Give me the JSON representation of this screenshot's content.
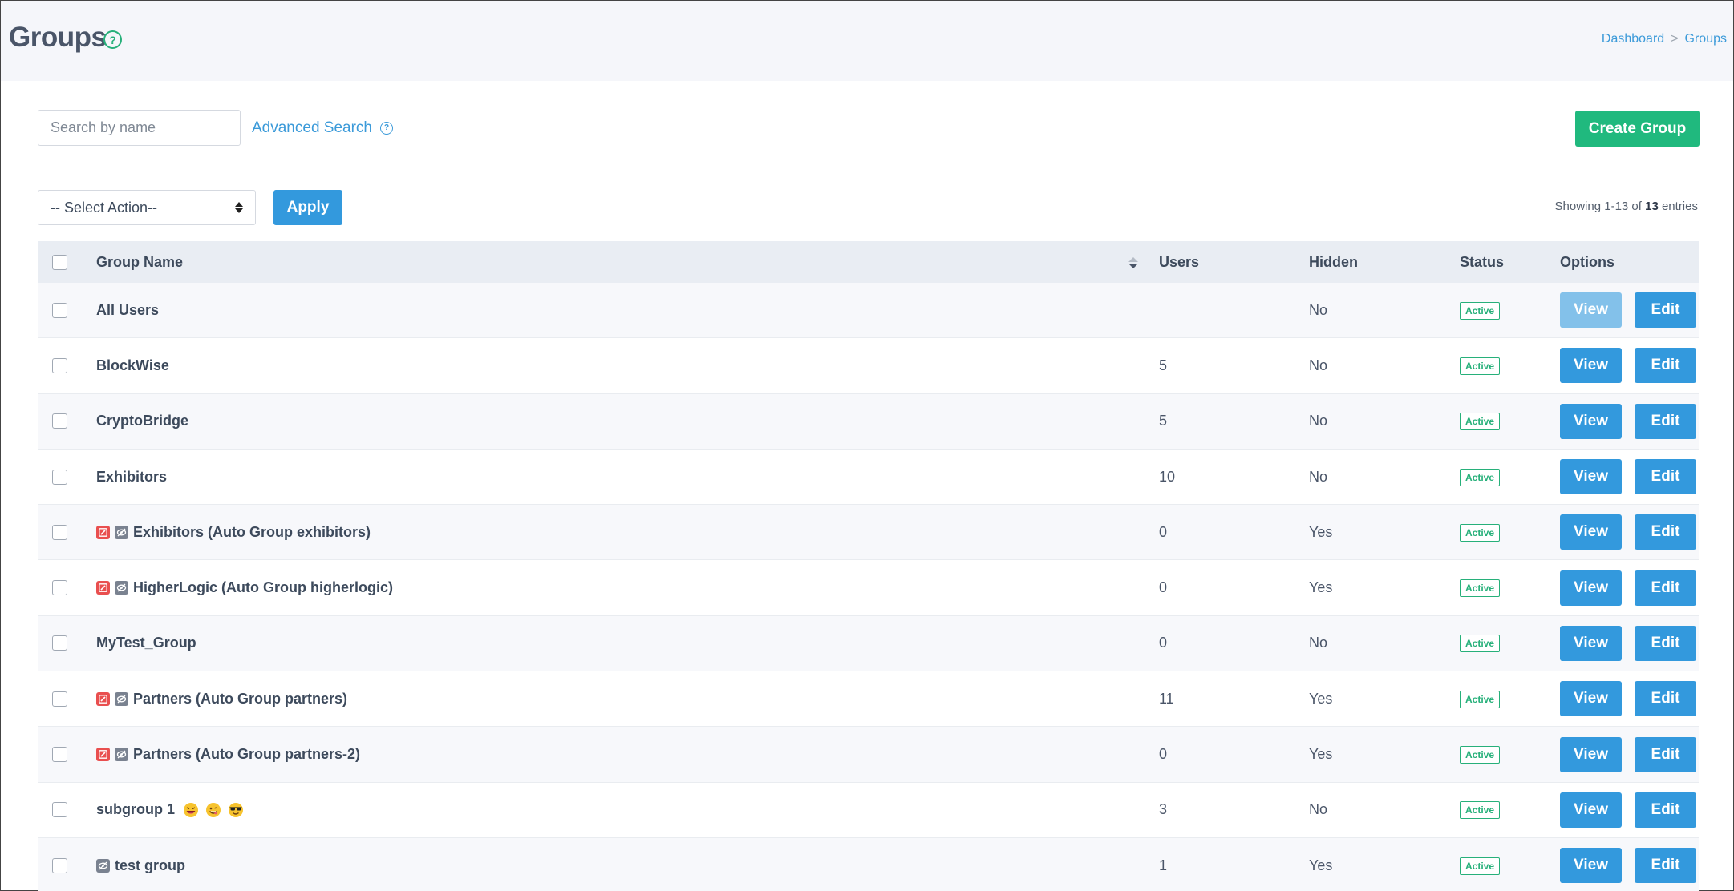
{
  "header": {
    "title": "Groups",
    "help_glyph": "?",
    "breadcrumb": [
      "Dashboard",
      "Groups"
    ],
    "breadcrumb_sep": ">"
  },
  "toolbar": {
    "search_placeholder": "Search by name",
    "advanced_search": "Advanced Search",
    "create_group": "Create Group",
    "select_action": "-- Select Action--",
    "apply": "Apply",
    "showing_prefix": "Showing 1-13 of ",
    "showing_total": "13",
    "showing_suffix": " entries"
  },
  "table": {
    "headers": {
      "name": "Group Name",
      "users": "Users",
      "hidden": "Hidden",
      "status": "Status",
      "options": "Options"
    },
    "view_label": "View",
    "edit_label": "Edit",
    "rows": [
      {
        "name": "All Users",
        "users": "",
        "hidden": "No",
        "status": "Active",
        "icons": [],
        "view_disabled": true
      },
      {
        "name": "BlockWise",
        "users": "5",
        "hidden": "No",
        "status": "Active",
        "icons": []
      },
      {
        "name": "CryptoBridge",
        "users": "5",
        "hidden": "No",
        "status": "Active",
        "icons": []
      },
      {
        "name": "Exhibitors",
        "users": "10",
        "hidden": "No",
        "status": "Active",
        "icons": []
      },
      {
        "name": "Exhibitors (Auto Group exhibitors)",
        "users": "0",
        "hidden": "Yes",
        "status": "Active",
        "icons": [
          "auto-group-icon",
          "hidden-icon"
        ]
      },
      {
        "name": "HigherLogic (Auto Group higherlogic)",
        "users": "0",
        "hidden": "Yes",
        "status": "Active",
        "icons": [
          "auto-group-icon",
          "hidden-icon"
        ]
      },
      {
        "name": "MyTest_Group",
        "users": "0",
        "hidden": "No",
        "status": "Active",
        "icons": []
      },
      {
        "name": "Partners (Auto Group partners)",
        "users": "11",
        "hidden": "Yes",
        "status": "Active",
        "icons": [
          "auto-group-icon",
          "hidden-icon"
        ]
      },
      {
        "name": "Partners (Auto Group partners-2)",
        "users": "0",
        "hidden": "Yes",
        "status": "Active",
        "icons": [
          "auto-group-icon",
          "hidden-icon"
        ]
      },
      {
        "name": "subgroup 1",
        "users": "3",
        "hidden": "No",
        "status": "Active",
        "icons": [],
        "emojis": [
          "laughing-emoji-icon",
          "winking-emoji-icon",
          "sunglasses-emoji-icon"
        ]
      },
      {
        "name": "test group",
        "users": "1",
        "hidden": "Yes",
        "status": "Active",
        "icons": [
          "hidden-icon"
        ]
      }
    ]
  },
  "colors": {
    "primary_blue": "#3399dd",
    "green": "#20b97e",
    "red_icon": "#e94f4f"
  }
}
